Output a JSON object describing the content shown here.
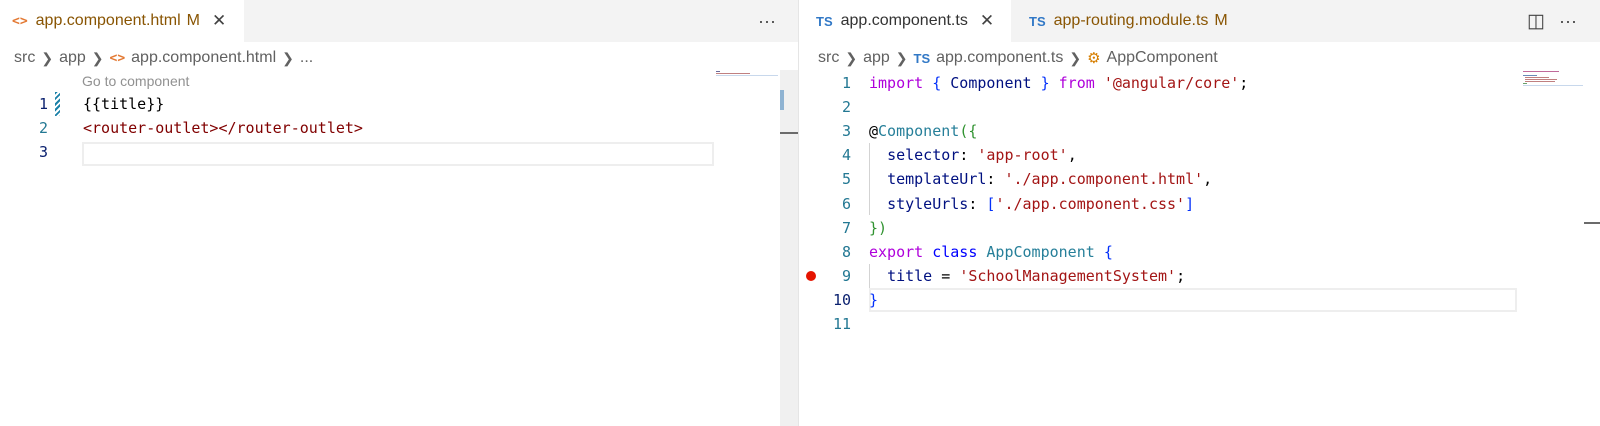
{
  "left_editor": {
    "tabs": [
      {
        "icon": "html-file-icon",
        "icon_glyph": "<>",
        "label": "app.component.html",
        "modified": "M",
        "close": "✕"
      }
    ],
    "more_actions": "···",
    "breadcrumb": {
      "items": [
        "src",
        "app"
      ],
      "file_icon_glyph": "<>",
      "file": "app.component.html",
      "ellipsis": "..."
    },
    "codelens": "Go to component",
    "line_numbers": [
      "1",
      "2",
      "3"
    ],
    "lines": {
      "l1": "{{title}}",
      "l2": "<router-outlet></router-outlet>"
    }
  },
  "right_editor": {
    "tabs": [
      {
        "icon_glyph": "TS",
        "label": "app.component.ts",
        "close": "✕"
      },
      {
        "icon_glyph": "TS",
        "label": "app-routing.module.ts",
        "modified": "M"
      }
    ],
    "split_icon": "◫",
    "more_actions": "···",
    "breadcrumb": {
      "items": [
        "src",
        "app"
      ],
      "file_icon_glyph": "TS",
      "file": "app.component.ts",
      "symbol": "AppComponent"
    },
    "line_numbers": [
      "1",
      "2",
      "3",
      "4",
      "5",
      "6",
      "7",
      "8",
      "9",
      "10",
      "11"
    ],
    "code": {
      "l1": {
        "kw": "import",
        "o": "{",
        "name": "Component",
        "c": "}",
        "from": "from",
        "str": "'@angular/core'",
        "semi": ";"
      },
      "l3": {
        "at": "@",
        "dec": "Component",
        "open": "(",
        "brace": "{"
      },
      "l4": {
        "key": "selector",
        "colon": ": ",
        "str": "'app-root'",
        "comma": ","
      },
      "l5": {
        "key": "templateUrl",
        "colon": ": ",
        "str": "'./app.component.html'",
        "comma": ","
      },
      "l6": {
        "key": "styleUrls",
        "colon": ": ",
        "ob": "[",
        "str": "'./app.component.css'",
        "cb": "]"
      },
      "l7": {
        "brace": "}",
        "close": ")"
      },
      "l8": {
        "kw1": "export",
        "kw2": "class",
        "name": "AppComponent",
        "brace": "{"
      },
      "l9": {
        "key": "title",
        "eq": " = ",
        "str": "'SchoolManagementSystem'",
        "semi": ";"
      },
      "l10": {
        "brace": "}"
      }
    },
    "breakpoint_line": "9"
  },
  "colors": {
    "breakpoint": "#e51400",
    "modified_tab": "#895503",
    "line_number": "#237893"
  }
}
